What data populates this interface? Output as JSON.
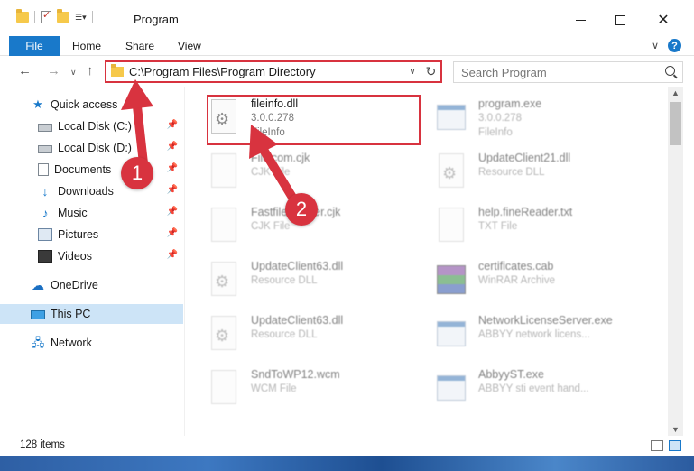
{
  "window": {
    "title": "Program"
  },
  "ribbon": {
    "tabs": [
      "File",
      "Home",
      "Share",
      "View"
    ]
  },
  "address": {
    "path": "C:\\Program Files\\Program Directory"
  },
  "search": {
    "placeholder": "Search Program"
  },
  "sidebar": {
    "items": [
      {
        "label": "Quick access",
        "icon": "star-icon",
        "pinned": false
      },
      {
        "label": "Local Disk (C:)",
        "icon": "disk-icon",
        "pinned": true
      },
      {
        "label": "Local Disk (D:)",
        "icon": "disk-icon",
        "pinned": true
      },
      {
        "label": "Documents",
        "icon": "documents-icon",
        "pinned": true
      },
      {
        "label": "Downloads",
        "icon": "download-icon",
        "pinned": true
      },
      {
        "label": "Music",
        "icon": "music-icon",
        "pinned": true
      },
      {
        "label": "Pictures",
        "icon": "pictures-icon",
        "pinned": true
      },
      {
        "label": "Videos",
        "icon": "videos-icon",
        "pinned": true
      },
      {
        "label": "OneDrive",
        "icon": "cloud-icon",
        "pinned": false
      },
      {
        "label": "This PC",
        "icon": "pc-icon",
        "pinned": false,
        "selected": true
      },
      {
        "label": "Network",
        "icon": "network-icon",
        "pinned": false
      }
    ]
  },
  "files": [
    {
      "name": "fileinfo.dll",
      "line2": "3.0.0.278",
      "line3": "FileInfo",
      "icon": "dll-icon",
      "highlight": true
    },
    {
      "name": "program.exe",
      "line2": "3.0.0.278",
      "line3": "FileInfo",
      "icon": "exe-icon"
    },
    {
      "name": "Fileicom.cjk",
      "line2": "CJK File",
      "line3": "",
      "icon": "file-icon"
    },
    {
      "name": "UpdateClient21.dll",
      "line2": "Resource DLL",
      "line3": "",
      "icon": "dll-icon"
    },
    {
      "name": "FastfileReader.cjk",
      "line2": "CJK File",
      "line3": "",
      "icon": "file-icon"
    },
    {
      "name": "help.fineReader.txt",
      "line2": "TXT File",
      "line3": "",
      "icon": "file-icon"
    },
    {
      "name": "UpdateClient63.dll",
      "line2": "Resource DLL",
      "line3": "",
      "icon": "dll-icon"
    },
    {
      "name": "certificates.cab",
      "line2": "WinRAR Archive",
      "line3": "",
      "icon": "archive-icon"
    },
    {
      "name": "UpdateClient63.dll",
      "line2": "Resource DLL",
      "line3": "",
      "icon": "dll-icon"
    },
    {
      "name": "NetworkLicenseServer.exe",
      "line2": "ABBYY network licens...",
      "line3": "",
      "icon": "exe-icon"
    },
    {
      "name": "SndToWP12.wcm",
      "line2": "WCM File",
      "line3": "",
      "icon": "file-icon"
    },
    {
      "name": "AbbyyST.exe",
      "line2": "ABBYY sti event hand...",
      "line3": "",
      "icon": "exe-icon"
    }
  ],
  "status": {
    "items_count": "128 items"
  },
  "annotations": {
    "step1": "1",
    "step2": "2",
    "color": "#d8333f"
  },
  "colors": {
    "accent": "#1979ca",
    "highlight": "#d8333f",
    "selected_bg": "#cde4f7"
  }
}
